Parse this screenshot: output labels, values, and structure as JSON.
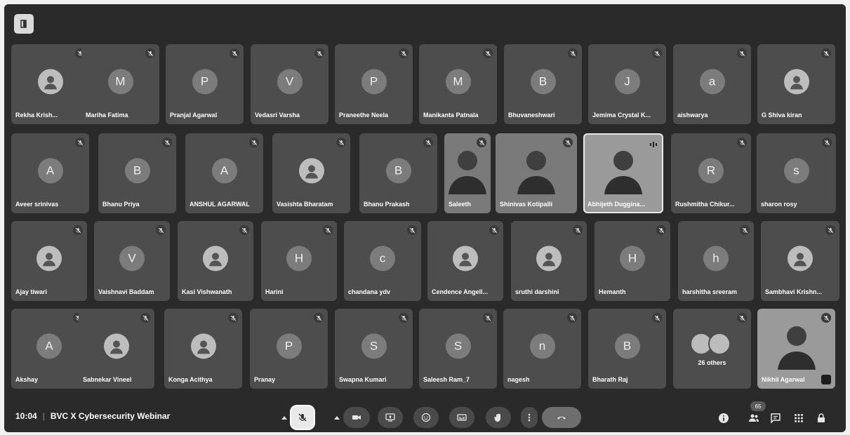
{
  "meeting": {
    "time": "10:04",
    "title": "BVC X Cybersecurity Webinar",
    "participant_count": "65"
  },
  "rows": [
    [
      {
        "name": "Rekha Krish...",
        "initial": "",
        "photo": true
      },
      {
        "name": "Mariha Fatima",
        "initial": "M"
      },
      {
        "name": "Pranjal Agarwal",
        "initial": "P"
      },
      {
        "name": "Vedasri Varsha",
        "initial": "V"
      },
      {
        "name": "Praneethe Neela",
        "initial": "P"
      },
      {
        "name": "Manikanta Patnala",
        "initial": "M"
      },
      {
        "name": "Bhuvaneshwari",
        "initial": "B"
      },
      {
        "name": "Jemima Crystal K...",
        "initial": "J"
      },
      {
        "name": "aishwarya",
        "initial": "a"
      },
      {
        "name": "G Shiva kiran",
        "initial": "",
        "photo": true
      }
    ],
    [
      {
        "name": "Aveer srinivas",
        "initial": "A"
      },
      {
        "name": "Bhanu Priya",
        "initial": "B"
      },
      {
        "name": "ANSHUL AGARWAL",
        "initial": "A"
      },
      {
        "name": "Vasishta Bharatam",
        "initial": "",
        "photo": true
      },
      {
        "name": "Bhanu Prakash",
        "initial": "B"
      },
      {
        "name": "Saleeth",
        "initial": "",
        "video": true
      },
      {
        "name": "Shinivas Kotipalli",
        "initial": "",
        "video": true
      },
      {
        "name": "Abhijeth Duggina...",
        "initial": "",
        "video": true,
        "speaking": true
      },
      {
        "name": "Rushmitha Chikur...",
        "initial": "R"
      },
      {
        "name": "sharon rosy",
        "initial": "s"
      }
    ],
    [
      {
        "name": "Ajay tiwari",
        "initial": "",
        "photo": true
      },
      {
        "name": "Vaishnavi Baddam",
        "initial": "V"
      },
      {
        "name": "Kasi Vishwanath",
        "initial": "",
        "photo": true
      },
      {
        "name": "Harini",
        "initial": "H"
      },
      {
        "name": "chandana ydv",
        "initial": "c"
      },
      {
        "name": "Cendence Angell...",
        "initial": "",
        "photo": true
      },
      {
        "name": "sruthi darshini",
        "initial": "",
        "photo": true
      },
      {
        "name": "Hemanth",
        "initial": "H"
      },
      {
        "name": "harshitha sreeram",
        "initial": "h"
      },
      {
        "name": "Sambhavi Krishn...",
        "initial": "",
        "photo": true
      }
    ],
    [
      {
        "name": "Akshay",
        "initial": "A"
      },
      {
        "name": "Sabnekar Vineel",
        "initial": "",
        "photo": true
      },
      {
        "name": "Konga Acithya",
        "initial": "",
        "photo": true
      },
      {
        "name": "Pranay",
        "initial": "P"
      },
      {
        "name": "Swapna Kumari",
        "initial": "S"
      },
      {
        "name": "Saleesh Ram_7",
        "initial": "S"
      },
      {
        "name": "nagesh",
        "initial": "n"
      },
      {
        "name": "Bharath Raj",
        "initial": "B"
      },
      {
        "name": "26 others",
        "initial": "",
        "others": true
      },
      {
        "name": "Nikhil Agarwal",
        "initial": "",
        "video": true,
        "self": true
      }
    ]
  ],
  "controls": {
    "icons": [
      "more-mic-options-icon",
      "mic-off-icon",
      "more-camera-options-icon",
      "camera-icon",
      "present-screen-icon",
      "emoji-icon",
      "captions-icon",
      "raise-hand-icon",
      "more-options-icon",
      "end-call-icon"
    ],
    "right_icons": [
      "info-icon",
      "people-icon",
      "chat-icon",
      "activities-icon",
      "host-controls-icon"
    ]
  },
  "colors": {
    "tile": "#4d4d4d",
    "background": "#2a2a2a",
    "end_call": "#6e6e6e"
  }
}
